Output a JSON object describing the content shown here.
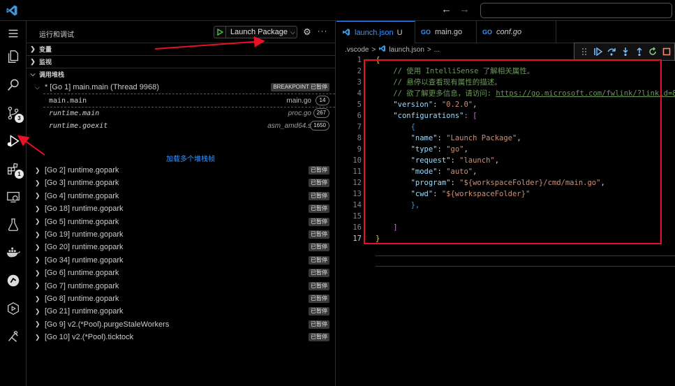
{
  "titlebar": {
    "logo": "vscode-logo-icon",
    "back_icon": "←",
    "forward_icon": "→",
    "search_placeholder": ""
  },
  "activity_bar": {
    "items": [
      {
        "name": "menu",
        "icon": "hamburger-icon"
      },
      {
        "name": "explorer",
        "icon": "files-icon"
      },
      {
        "name": "search",
        "icon": "search-icon"
      },
      {
        "name": "source-control",
        "icon": "source-control-icon",
        "badge": "3"
      },
      {
        "name": "run-and-debug",
        "icon": "debug-icon"
      },
      {
        "name": "extensions",
        "icon": "extensions-icon",
        "badge": "1"
      },
      {
        "name": "remote-explorer",
        "icon": "remote-icon"
      },
      {
        "name": "testing",
        "icon": "flask-icon"
      },
      {
        "name": "docker",
        "icon": "docker-icon"
      },
      {
        "name": "gitlens",
        "icon": "gitlens-icon"
      },
      {
        "name": "play",
        "icon": "play-circle-icon"
      },
      {
        "name": "tools",
        "icon": "tools-icon"
      }
    ]
  },
  "sidebar": {
    "title": "运行和调试",
    "config": {
      "start_icon": "▷",
      "selected": "Launch Package",
      "chevron": "⌵"
    },
    "gear": "⚙",
    "more": "···",
    "sections": {
      "variables": "变量",
      "watch": "监视",
      "call_stack": "调用堆栈"
    },
    "main_thread": {
      "label": "* [Go 1] main.main (Thread 9968)",
      "breakpoint_badge": "BREAKPOINT 已暂停"
    },
    "frames": [
      {
        "name": "main.main",
        "file": "main.go",
        "line": "14"
      },
      {
        "name": "runtime.main",
        "file": "proc.go",
        "line": "267"
      },
      {
        "name": "runtime.goexit",
        "file": "asm_amd64.s",
        "line": "1650"
      }
    ],
    "load_more": "加载多个堆栈帧",
    "paused_label": "已暂停",
    "threads": [
      "[Go 2] runtime.gopark",
      "[Go 3] runtime.gopark",
      "[Go 4] runtime.gopark",
      "[Go 18] runtime.gopark",
      "[Go 5] runtime.gopark",
      "[Go 19] runtime.gopark",
      "[Go 20] runtime.gopark",
      "[Go 34] runtime.gopark",
      "[Go 6] runtime.gopark",
      "[Go 7] runtime.gopark",
      "[Go 8] runtime.gopark",
      "[Go 21] runtime.gopark",
      "[Go 9] v2.(*Pool).purgeStaleWorkers",
      "[Go 10] v2.(*Pool).ticktock"
    ]
  },
  "editor": {
    "tabs": [
      {
        "icon": "json-icon",
        "label": "launch.json",
        "modified": "U"
      },
      {
        "icon": "go-icon",
        "label": "main.go"
      },
      {
        "icon": "go-icon",
        "label": "conf.go"
      }
    ],
    "breadcrumb": [
      ".vscode",
      ">",
      "launch.json",
      ">",
      "..."
    ],
    "debug_toolbar": [
      "drag-handle-icon",
      "continue-icon",
      "step-over-icon",
      "step-into-icon",
      "step-out-icon",
      "restart-icon",
      "stop-icon"
    ],
    "lines": [
      {
        "n": "1",
        "text": "{"
      },
      {
        "n": "2",
        "text": "    // 使用 IntelliSense 了解相关属性。"
      },
      {
        "n": "3",
        "text": "    // 悬停以查看现有属性的描述。"
      },
      {
        "n": "4",
        "text": "    // 欲了解更多信息，请访问: ",
        "link": "https://go.microsoft.com/fwlink/?linkid=830387"
      },
      {
        "n": "5",
        "key": "\"version\"",
        "value": "\"0.2.0\"",
        "tail": ","
      },
      {
        "n": "6",
        "key": "\"configurations\"",
        "tail": ": ["
      },
      {
        "n": "7",
        "text": "        {"
      },
      {
        "n": "8",
        "key": "\"name\"",
        "value": "\"Launch Package\"",
        "tail": ","
      },
      {
        "n": "9",
        "key": "\"type\"",
        "value": "\"go\"",
        "tail": ","
      },
      {
        "n": "10",
        "key": "\"request\"",
        "value": "\"launch\"",
        "tail": ","
      },
      {
        "n": "11",
        "key": "\"mode\"",
        "value": "\"auto\"",
        "tail": ","
      },
      {
        "n": "12",
        "key": "\"program\"",
        "value": "\"${workspaceFolder}/cmd/main.go\"",
        "tail": ","
      },
      {
        "n": "13",
        "key": "\"cwd\"",
        "value": "\"${workspaceFolder}\"",
        "tail": ""
      },
      {
        "n": "14",
        "text": "        },"
      },
      {
        "n": "15",
        "text": ""
      },
      {
        "n": "16",
        "text": "    ]"
      },
      {
        "n": "17",
        "text": "}"
      }
    ]
  },
  "colors": {
    "accent": "#3794ff",
    "annotation_red": "#e81123",
    "comment": "#6a9955",
    "key": "#9cdcfe",
    "string": "#ce9178"
  }
}
